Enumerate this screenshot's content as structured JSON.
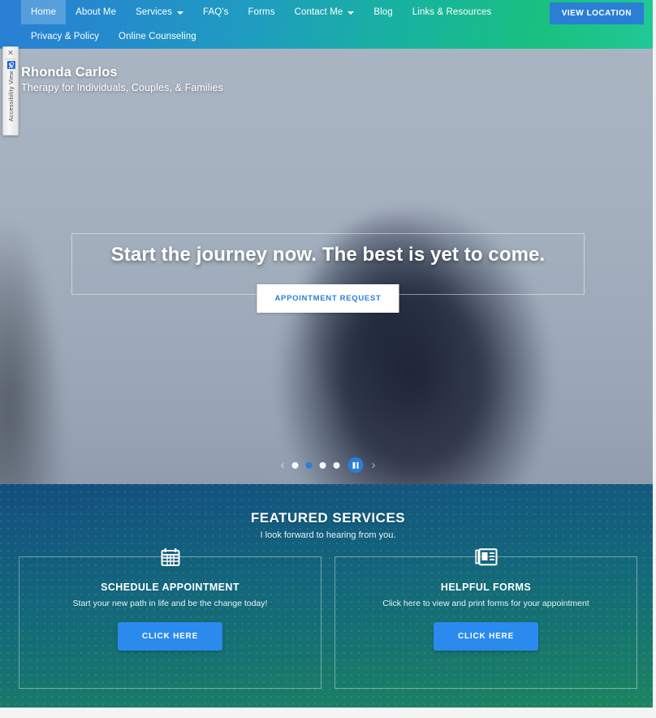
{
  "nav": {
    "primary": [
      {
        "label": "Home",
        "active": true,
        "dropdown": false
      },
      {
        "label": "About Me",
        "active": false,
        "dropdown": false
      },
      {
        "label": "Services",
        "active": false,
        "dropdown": true
      },
      {
        "label": "FAQ's",
        "active": false,
        "dropdown": false
      },
      {
        "label": "Forms",
        "active": false,
        "dropdown": false
      },
      {
        "label": "Contact Me",
        "active": false,
        "dropdown": true
      },
      {
        "label": "Blog",
        "active": false,
        "dropdown": false
      },
      {
        "label": "Links & Resources",
        "active": false,
        "dropdown": false
      }
    ],
    "secondary": [
      {
        "label": "Privacy & Policy"
      },
      {
        "label": "Online Counseling"
      }
    ],
    "cta_label": "VIEW LOCATION",
    "gradient_start": "#2a7fd4",
    "gradient_end": "#20c997"
  },
  "accessibility_widget": {
    "close_label": "✕",
    "label": "Accessibility View",
    "icon": "wheelchair-icon",
    "icon_glyph": "♿"
  },
  "hero": {
    "site_name": "Rhonda Carlos",
    "tagline": "Therapy for Individuals, Couples, & Families",
    "headline": "Start the journey now. The best is yet to come.",
    "cta_label": "APPOINTMENT REQUEST",
    "cta_text_color": "#2a7fd4"
  },
  "carousel": {
    "prev_glyph": "‹",
    "next_glyph": "›",
    "slides": [
      {
        "active": false
      },
      {
        "active": true
      },
      {
        "active": false
      },
      {
        "active": false
      }
    ],
    "playing": true,
    "active_color": "#2a7fd4"
  },
  "services": {
    "heading": "FEATURED SERVICES",
    "subheading": "I look forward to hearing from you.",
    "accent_color": "#2a8aee",
    "cards": [
      {
        "icon": "calendar-icon",
        "title": "SCHEDULE APPOINTMENT",
        "desc": "Start your new path in life and be the change today!",
        "button_label": "CLICK HERE"
      },
      {
        "icon": "newspaper-icon",
        "title": "HELPFUL FORMS",
        "desc": "Click here to view and print forms for your appointment",
        "button_label": "CLICK HERE"
      }
    ]
  }
}
